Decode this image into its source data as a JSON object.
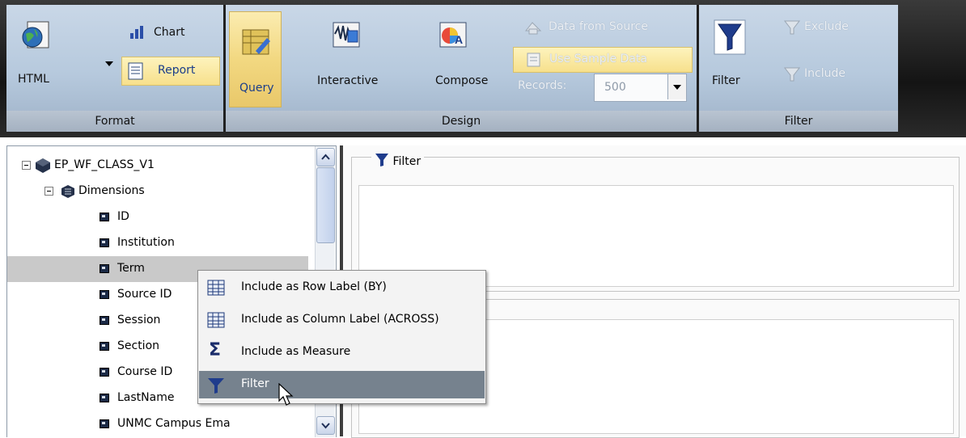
{
  "ribbon": {
    "groups": {
      "format": "Format",
      "design": "Design",
      "filter": "Filter"
    },
    "format": {
      "html_label": "HTML",
      "chart_label": "Chart",
      "report_label": "Report"
    },
    "design": {
      "query_label": "Query",
      "interactive_label": "Interactive",
      "compose_label": "Compose",
      "data_from_source_label": "Data from Source",
      "use_sample_data_label": "Use Sample Data",
      "records_label": "Records:",
      "records_value": "500"
    },
    "filter": {
      "filter_label": "Filter",
      "exclude_label": "Exclude",
      "include_label": "Include"
    }
  },
  "tree": {
    "root": "EP_WF_CLASS_V1",
    "dimensions": "Dimensions",
    "fields": [
      "ID",
      "Institution",
      "Term",
      "Source ID",
      "Session",
      "Section",
      "Course ID",
      "LastName",
      "UNMC Campus Ema"
    ],
    "selected_field": "Term"
  },
  "right_panel": {
    "filter_title": "Filter"
  },
  "context_menu": {
    "items": [
      {
        "label": "Include as Row Label (BY)",
        "icon": "table-icon"
      },
      {
        "label": "Include as Column Label (ACROSS)",
        "icon": "table-icon"
      },
      {
        "label": "Include as Measure",
        "icon": "sigma-icon"
      },
      {
        "label": "Filter",
        "icon": "funnel-icon"
      }
    ],
    "active_item": "Filter"
  },
  "colors": {
    "ribbon_group_bg": "#b6c9dd",
    "selected_button": "#f2d881",
    "menu_active": "#76828e",
    "tree_selected": "#c9c9c9"
  }
}
